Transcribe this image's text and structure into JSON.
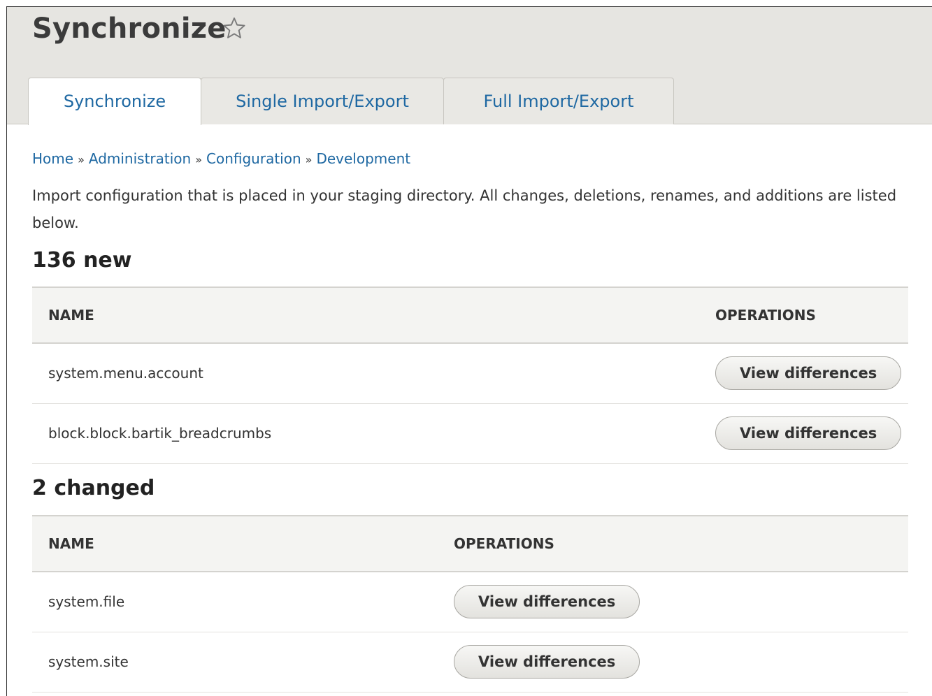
{
  "page": {
    "title": "Synchronize",
    "favorite_icon": "star-outline-icon"
  },
  "tabs": [
    {
      "label": "Synchronize",
      "active": true
    },
    {
      "label": "Single Import/Export",
      "active": false
    },
    {
      "label": "Full Import/Export",
      "active": false
    }
  ],
  "breadcrumb": {
    "items": [
      "Home",
      "Administration",
      "Configuration",
      "Development"
    ],
    "separator": "»"
  },
  "description": "Import configuration that is placed in your staging directory. All changes, deletions, renames, and additions are listed below.",
  "sections": [
    {
      "title": "136 new",
      "headers": {
        "name": "NAME",
        "operations": "OPERATIONS"
      },
      "rows": [
        {
          "name": "system.menu.account",
          "button": "View differences"
        },
        {
          "name": "block.block.bartik_breadcrumbs",
          "button": "View differences"
        }
      ]
    },
    {
      "title": "2 changed",
      "headers": {
        "name": "NAME",
        "operations": "OPERATIONS"
      },
      "rows": [
        {
          "name": "system.file",
          "button": "View differences"
        },
        {
          "name": "system.site",
          "button": "View differences"
        }
      ]
    }
  ],
  "colors": {
    "link": "#1e68a2",
    "header_bg": "#e6e5e1",
    "table_header_bg": "#f4f4f2"
  }
}
